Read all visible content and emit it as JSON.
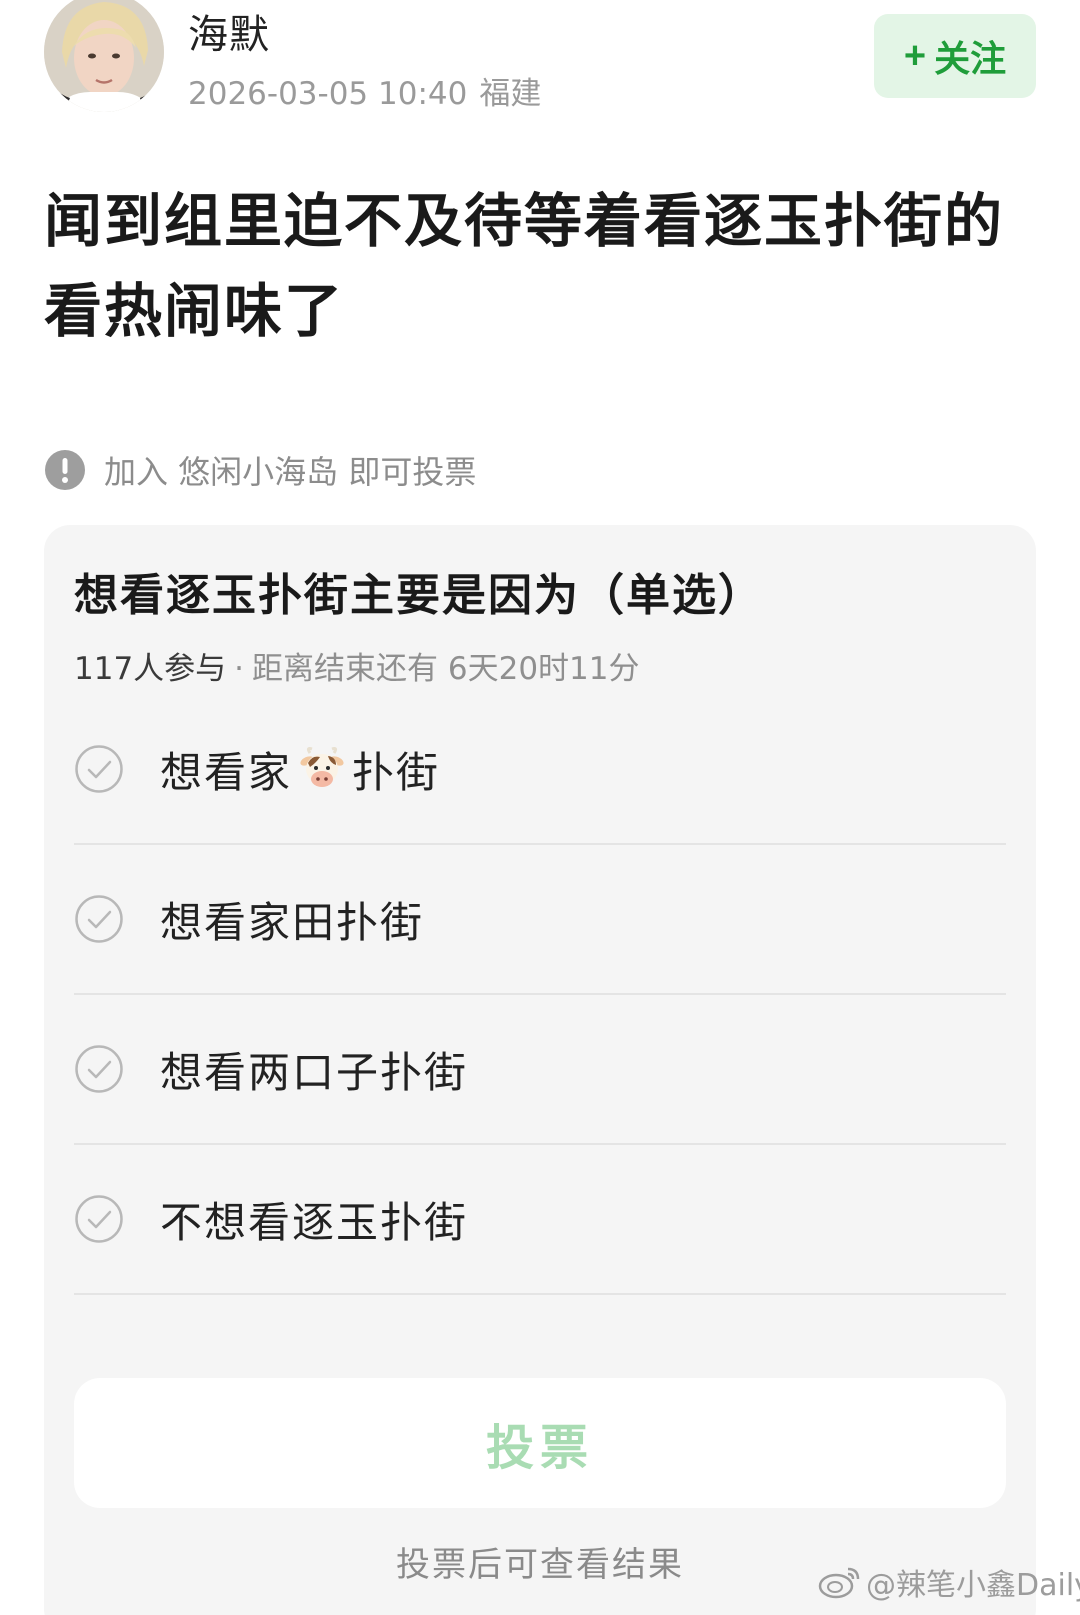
{
  "author": {
    "name": "海默",
    "date": "2026-03-05 10:40",
    "location": "福建",
    "follow_label": "关注"
  },
  "post": {
    "title": "闻到组里迫不及待等着看逐玉扑街的看热闹味了"
  },
  "notice": {
    "text": "加入 悠闲小海岛 即可投票"
  },
  "poll": {
    "question": "想看逐玉扑街主要是因为（单选）",
    "participants": "117人参与",
    "separator": "·",
    "time_left": "距离结束还有 6天20时11分",
    "options": [
      {
        "before": "想看家",
        "after": "扑街",
        "icon": "cow-emoji"
      },
      {
        "label": "想看家田扑街"
      },
      {
        "label": "想看两口子扑街"
      },
      {
        "label": "不想看逐玉扑街"
      }
    ],
    "vote_label": "投票",
    "vote_hint": "投票后可查看结果"
  },
  "watermark": {
    "text": "@辣笔小鑫Daily"
  },
  "colors": {
    "accent_green": "#1f9d3a",
    "follow_bg": "#e3f5e6",
    "vote_disabled": "#a9dcb3",
    "card_bg": "#f5f5f5"
  }
}
